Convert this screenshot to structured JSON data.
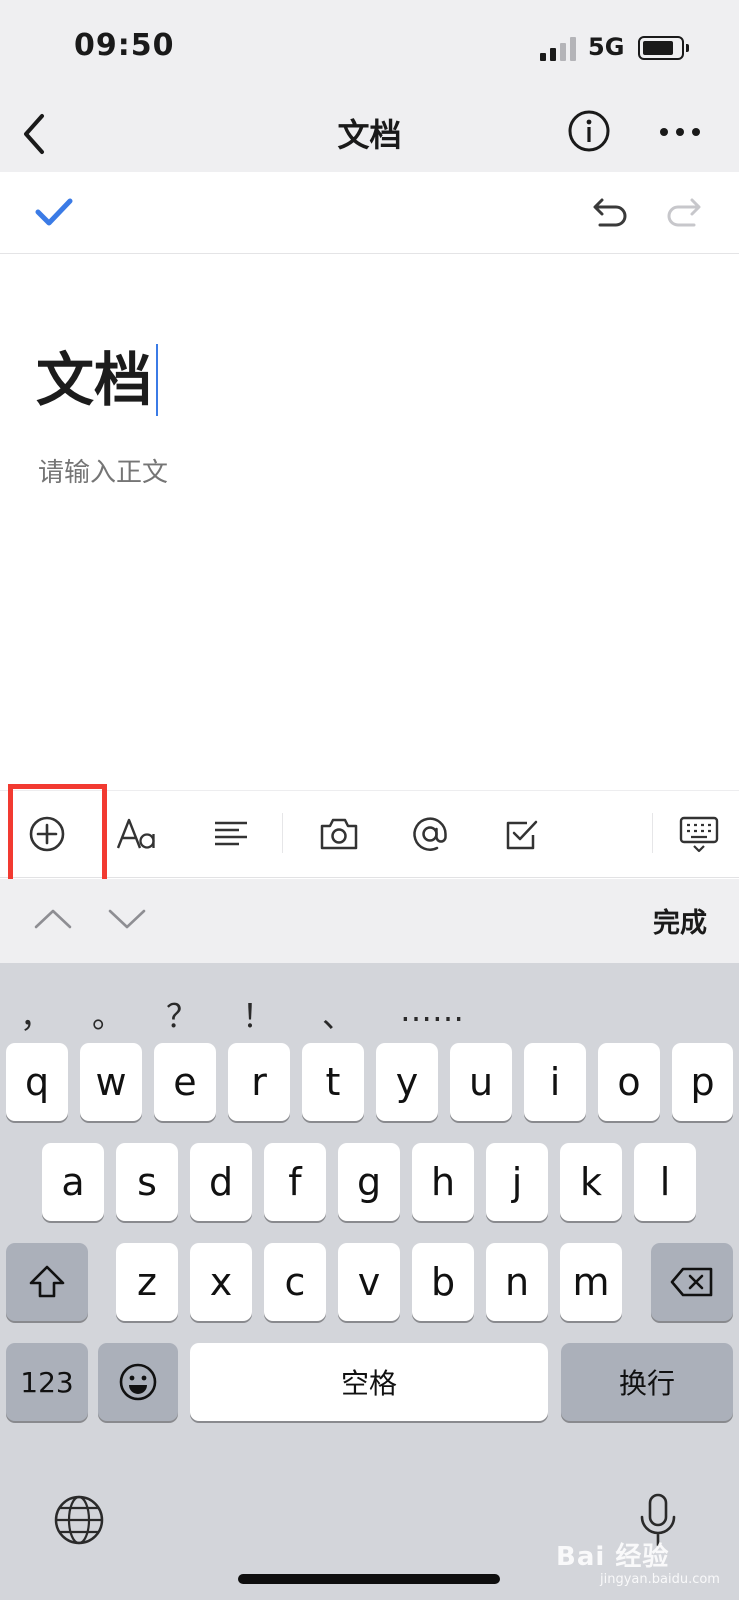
{
  "status": {
    "time": "09:50",
    "network": "5G",
    "signal_bars": 2,
    "signal_bars_total": 4,
    "battery_level": 0.75
  },
  "nav": {
    "title": "文档",
    "back_icon": "chevron-left-icon",
    "info_icon": "info-circle-icon",
    "more_icon": "more-dots-icon"
  },
  "edit_toolbar": {
    "done_icon": "checkmark-icon",
    "undo_icon": "undo-icon",
    "redo_icon": "redo-icon"
  },
  "document": {
    "title": "文档",
    "body_placeholder": "请输入正文"
  },
  "format_toolbar": {
    "icons": [
      "plus-circle-icon",
      "text-format-icon",
      "align-icon",
      "camera-icon",
      "at-mention-icon",
      "checkbox-icon",
      "keyboard-hide-icon"
    ]
  },
  "keyboard_accessory": {
    "prev_icon": "chevron-up-icon",
    "next_icon": "chevron-down-icon",
    "done_label": "完成"
  },
  "keyboard": {
    "punctuation": [
      "，",
      "。",
      "？",
      "！",
      "、",
      "……"
    ],
    "row1": [
      "q",
      "w",
      "e",
      "r",
      "t",
      "y",
      "u",
      "i",
      "o",
      "p"
    ],
    "row2": [
      "a",
      "s",
      "d",
      "f",
      "g",
      "h",
      "j",
      "k",
      "l"
    ],
    "row3": [
      "z",
      "x",
      "c",
      "v",
      "b",
      "n",
      "m"
    ],
    "numbers_label": "123",
    "space_label": "空格",
    "return_label": "换行"
  },
  "watermark": {
    "text": "Bai 经验",
    "sub": "jingyan.baidu.com"
  },
  "colors": {
    "accent": "#3b7be6",
    "highlight": "#f23a31",
    "keyboard_bg": "#d3d5da"
  }
}
